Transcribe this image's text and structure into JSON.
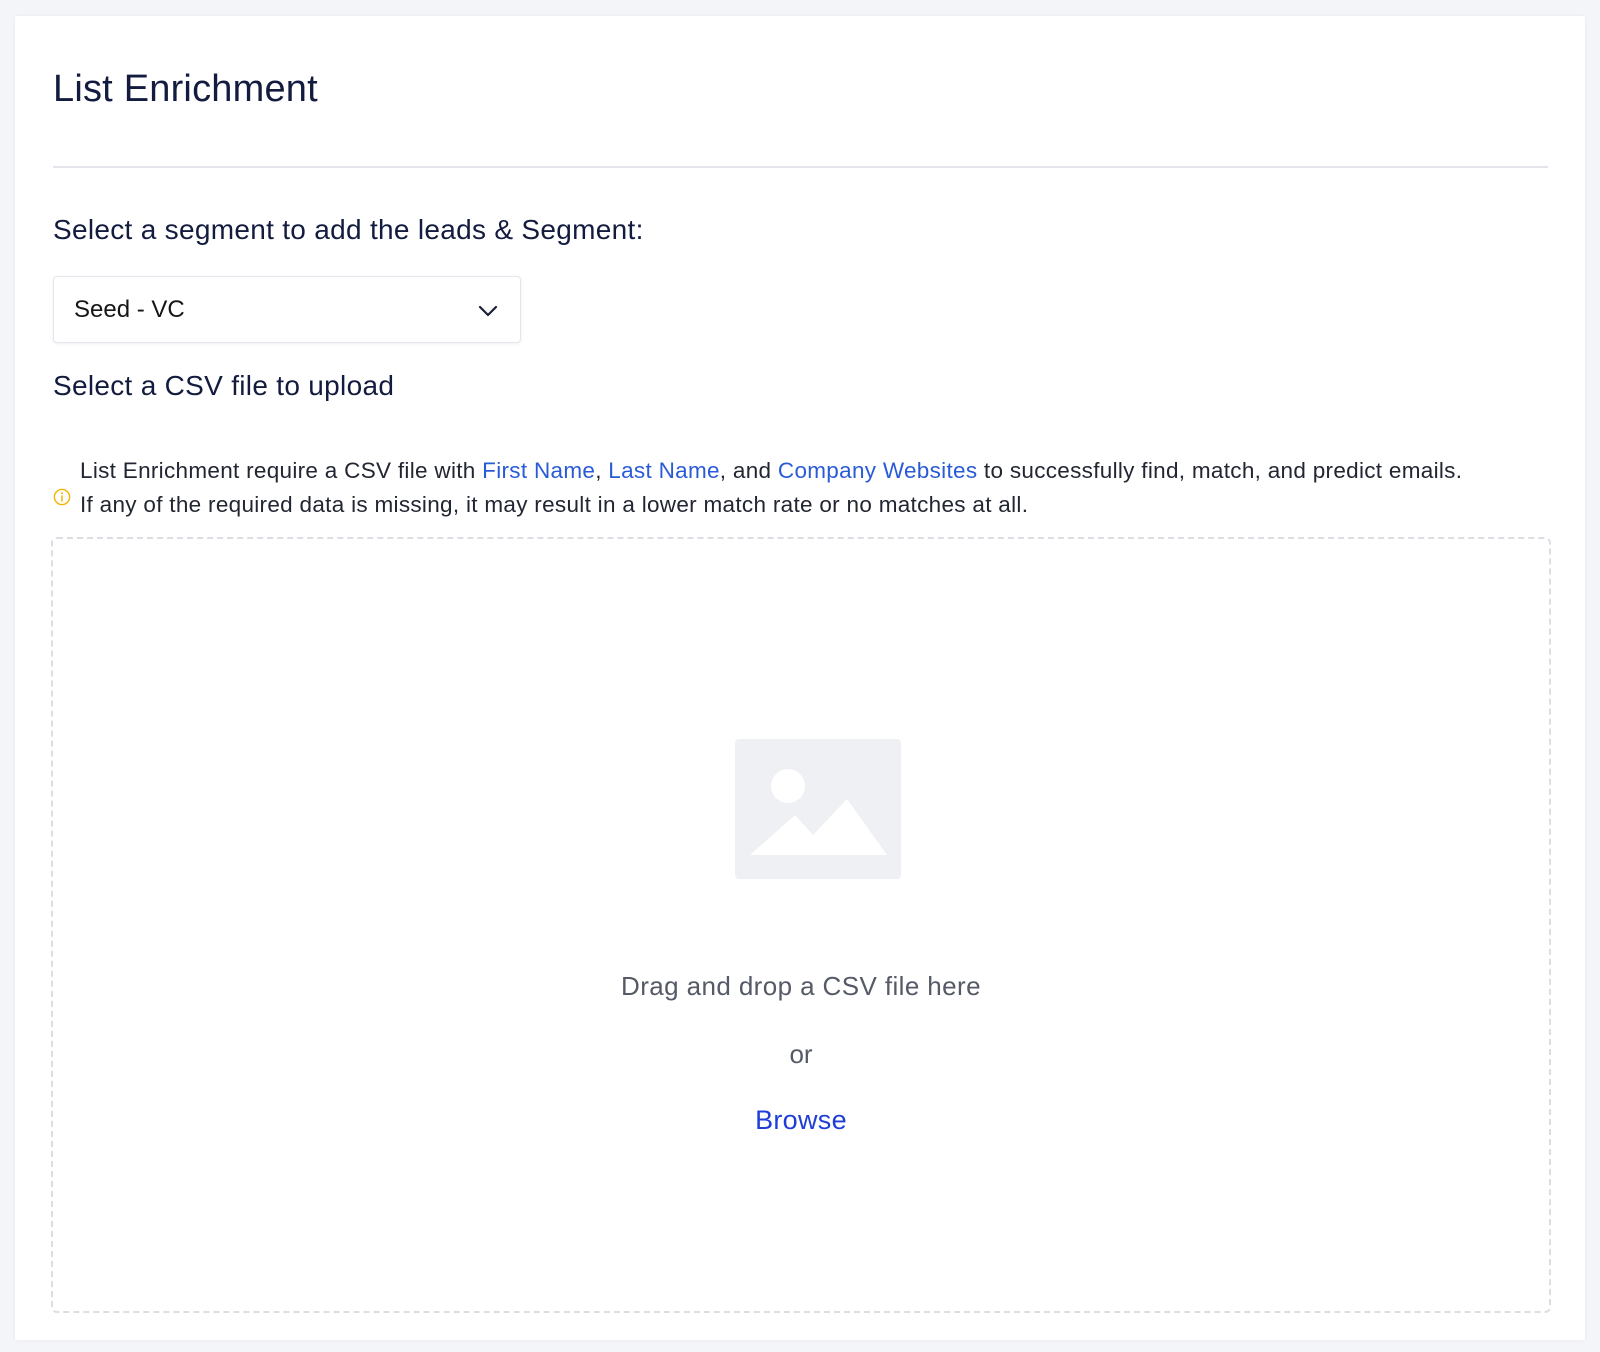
{
  "page": {
    "title": "List Enrichment"
  },
  "segment": {
    "label": "Select a segment to add the leads & Segment:",
    "selected_value": "Seed - VC",
    "chevron_icon": "chevron-down-icon"
  },
  "upload": {
    "label": "Select a CSV file to upload",
    "notice": {
      "icon": "info-icon",
      "icon_color": "#f5b400",
      "text_before": "List Enrichment require a CSV file with ",
      "link_first_name": "First Name",
      "sep_1": ", ",
      "link_last_name": "Last Name",
      "sep_2": ", and ",
      "link_company_websites": "Company Websites",
      "text_after_line1": " to successfully find, match, and predict emails.",
      "text_line2": "If any of the required data is missing, it may result in a lower match rate or no matches at all."
    },
    "dropzone": {
      "icon": "image-placeholder-icon",
      "drag_text": "Drag and drop a CSV file here",
      "or_text": "or",
      "browse_label": "Browse"
    }
  },
  "colors": {
    "heading": "#131b3f",
    "link": "#2a5bd7",
    "browse": "#1f3ed8",
    "background": "#f4f5f9"
  }
}
